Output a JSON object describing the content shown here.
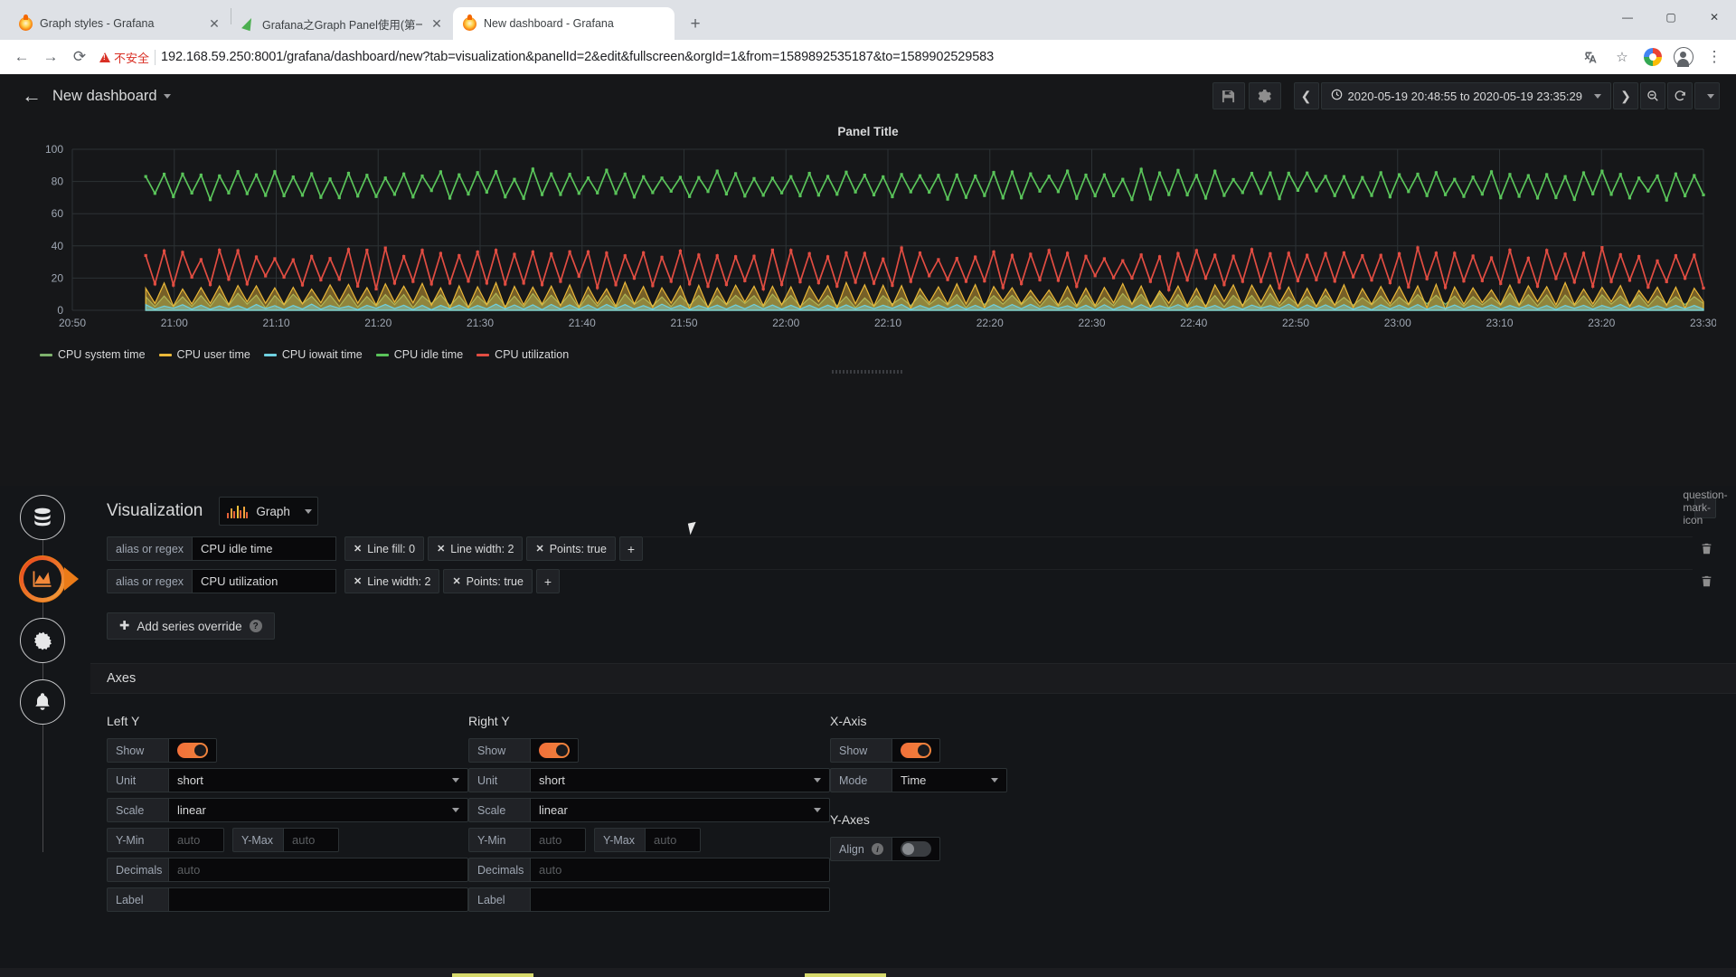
{
  "browser": {
    "tabs": [
      {
        "title": "Graph styles - Grafana",
        "favicon": "grafana-icon",
        "active": false
      },
      {
        "title": "Grafana之Graph Panel使用(第一",
        "favicon": "leaf-icon",
        "active": false
      },
      {
        "title": "New dashboard - Grafana",
        "favicon": "grafana-icon",
        "active": true
      }
    ],
    "new_tab_label": "+",
    "close_label": "✕",
    "window_controls": {
      "minimize": "—",
      "maximize": "▢",
      "close": "✕"
    },
    "nav": {
      "back": "←",
      "forward": "→",
      "reload": "⟳",
      "security_label": "不安全",
      "url": "192.168.59.250:8001/grafana/dashboard/new?tab=visualization&panelId=2&edit&fullscreen&orgId=1&from=1589892535187&to=1589902529583",
      "translate_icon": "translate-icon",
      "star_icon": "star-icon",
      "profile_icon": "profile-icon",
      "menu_icon": "kebab-menu-icon"
    }
  },
  "grafana": {
    "topbar": {
      "back_icon": "back-arrow-icon",
      "dashboard_title": "New dashboard",
      "save_icon": "save-disk-icon",
      "settings_icon": "gear-icon",
      "time_prev": "❮",
      "time_next": "❯",
      "time_range": "2020-05-19 20:48:55 to 2020-05-19 23:35:29",
      "clock_icon": "clock-icon",
      "zoom_out_icon": "zoom-out-icon",
      "refresh_icon": "refresh-icon"
    },
    "panel": {
      "title": "Panel Title"
    },
    "editor": {
      "section_label": "Visualization",
      "viz_type": "Graph",
      "viz_icon": "bar-chart-icon",
      "help_icon": "question-mark-icon",
      "overrides": [
        {
          "label": "alias or regex",
          "value": "CPU idle time",
          "chips": [
            "Line fill: 0",
            "Line width: 2",
            "Points: true"
          ],
          "add_label": "+",
          "delete_icon": "trash-icon"
        },
        {
          "label": "alias or regex",
          "value": "CPU utilization",
          "chips": [
            "Line width: 2",
            "Points: true"
          ],
          "add_label": "+",
          "delete_icon": "trash-icon"
        }
      ],
      "add_override_label": "Add series override",
      "add_override_help": "?",
      "axes_header": "Axes",
      "left_y": {
        "title": "Left Y",
        "show_label": "Show",
        "show_on": true,
        "unit_label": "Unit",
        "unit_value": "short",
        "scale_label": "Scale",
        "scale_value": "linear",
        "ymin_label": "Y-Min",
        "ymin_placeholder": "auto",
        "ymax_label": "Y-Max",
        "ymax_placeholder": "auto",
        "decimals_label": "Decimals",
        "decimals_placeholder": "auto",
        "axis_label": "Label",
        "axis_value": ""
      },
      "right_y": {
        "title": "Right Y",
        "show_label": "Show",
        "show_on": true,
        "unit_label": "Unit",
        "unit_value": "short",
        "scale_label": "Scale",
        "scale_value": "linear",
        "ymin_label": "Y-Min",
        "ymin_placeholder": "auto",
        "ymax_label": "Y-Max",
        "ymax_placeholder": "auto",
        "decimals_label": "Decimals",
        "decimals_placeholder": "auto",
        "axis_label": "Label",
        "axis_value": ""
      },
      "x_axis": {
        "title": "X-Axis",
        "show_label": "Show",
        "show_on": true,
        "mode_label": "Mode",
        "mode_value": "Time"
      },
      "y_axes": {
        "title": "Y-Axes",
        "align_label": "Align",
        "align_on": false,
        "info_icon": "info-icon"
      },
      "rail": [
        {
          "name": "queries-tab",
          "icon": "database-icon",
          "active": false
        },
        {
          "name": "visualization-tab",
          "icon": "area-chart-icon",
          "active": true
        },
        {
          "name": "general-tab",
          "icon": "gear-wrench-icon",
          "active": false
        },
        {
          "name": "alert-tab",
          "icon": "bell-icon",
          "active": false
        }
      ]
    }
  },
  "chart_data": {
    "type": "line",
    "title": "Panel Title",
    "xlabel": "",
    "ylabel": "",
    "ylim": [
      0,
      100
    ],
    "yticks": [
      0,
      20,
      40,
      60,
      80,
      100
    ],
    "xticks": [
      "20:50",
      "21:00",
      "21:10",
      "21:20",
      "21:30",
      "21:40",
      "21:50",
      "22:00",
      "22:10",
      "22:20",
      "22:30",
      "22:40",
      "22:50",
      "23:00",
      "23:10",
      "23:20",
      "23:30"
    ],
    "grid": true,
    "legend_position": "bottom-left",
    "series": [
      {
        "name": "CPU system time",
        "color": "#7eb26d",
        "mean": 6,
        "amplitude": 4,
        "fill": true,
        "points": false
      },
      {
        "name": "CPU user time",
        "color": "#eab839",
        "mean": 9,
        "amplitude": 7,
        "fill": true,
        "points": false
      },
      {
        "name": "CPU iowait time",
        "color": "#6ed0e0",
        "mean": 2,
        "amplitude": 1.5,
        "fill": true,
        "points": false
      },
      {
        "name": "CPU idle time",
        "color": "#5ac45a",
        "mean": 78,
        "amplitude": 8,
        "fill": false,
        "points": true
      },
      {
        "name": "CPU utilization",
        "color": "#e24d42",
        "mean": 26,
        "amplitude": 11,
        "fill": false,
        "points": true
      }
    ]
  }
}
